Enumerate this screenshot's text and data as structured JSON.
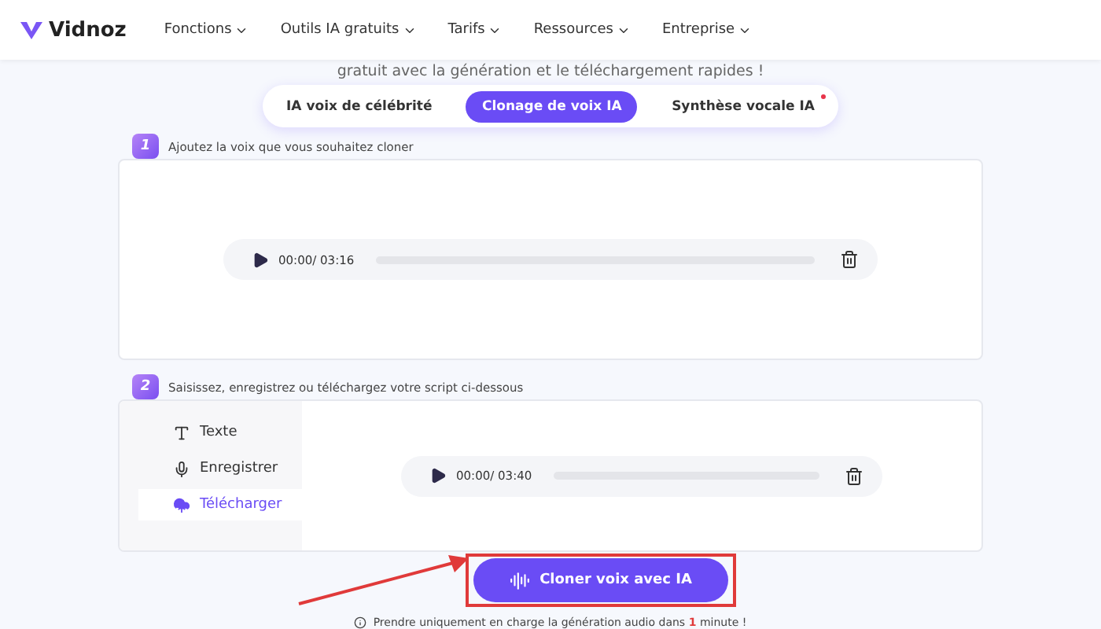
{
  "header": {
    "logo": "Vidnoz",
    "menu": [
      {
        "label": "Fonctions"
      },
      {
        "label": "Outils IA gratuits"
      },
      {
        "label": "Tarifs"
      },
      {
        "label": "Ressources"
      },
      {
        "label": "Entreprise"
      }
    ]
  },
  "subtitle": "gratuit avec la génération et le téléchargement rapides !",
  "tabs": [
    {
      "label": "IA voix de célébrité",
      "selected": false,
      "dot": false
    },
    {
      "label": "Clonage de voix IA",
      "selected": true,
      "dot": false
    },
    {
      "label": "Synthèse vocale IA",
      "selected": false,
      "dot": true
    }
  ],
  "step1": {
    "number": "1",
    "label": "Ajoutez la voix que vous souhaitez cloner",
    "player": {
      "time": "00:00/ 03:16"
    }
  },
  "step2": {
    "number": "2",
    "label": "Saisissez, enregistrez ou téléchargez votre script ci-dessous",
    "options": [
      {
        "kind": "text",
        "label": "Texte",
        "selected": false
      },
      {
        "kind": "record",
        "label": "Enregistrer",
        "selected": false
      },
      {
        "kind": "upload",
        "label": "Télécharger",
        "selected": true
      }
    ],
    "player": {
      "time": "00:00/ 03:40"
    }
  },
  "action": {
    "label": "Cloner voix avec IA",
    "highlighted": true
  },
  "note": {
    "before": "Prendre uniquement en charge la génération audio dans",
    "highlight": "1",
    "after": "minute !"
  }
}
